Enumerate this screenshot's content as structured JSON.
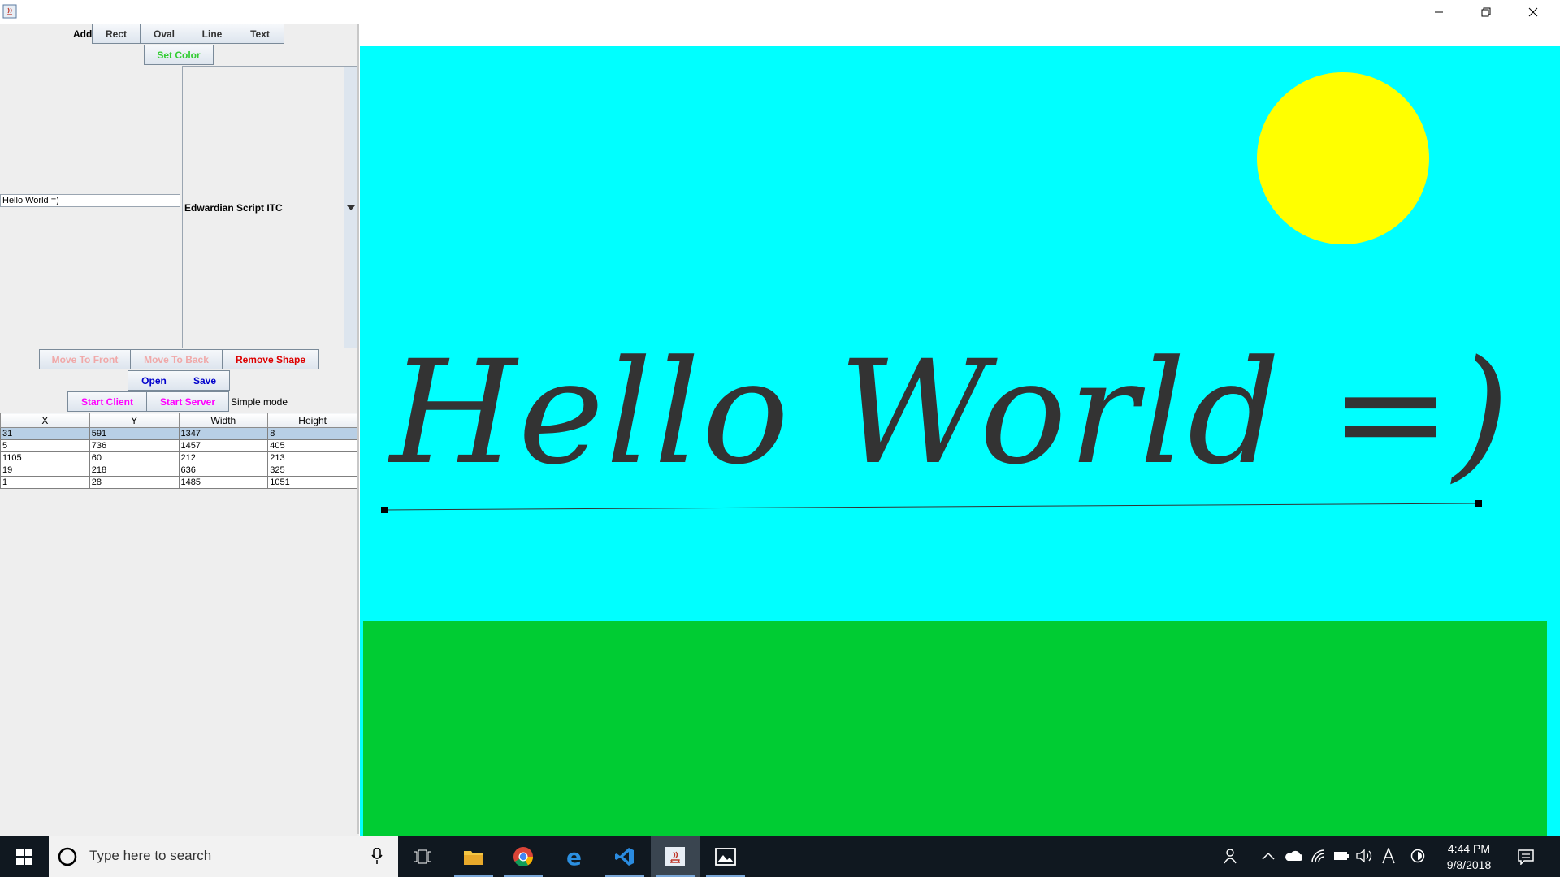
{
  "toolbar": {
    "add_label": "Add",
    "rect_label": "Rect",
    "oval_label": "Oval",
    "line_label": "Line",
    "text_label": "Text",
    "set_color_label": "Set Color"
  },
  "text_input": {
    "value": "Hello World =)"
  },
  "font_select": {
    "value": "Edwardian Script ITC"
  },
  "actions": {
    "move_front_label": "Move To Front",
    "move_back_label": "Move To Back",
    "remove_label": "Remove Shape",
    "open_label": "Open",
    "save_label": "Save",
    "start_client_label": "Start Client",
    "start_server_label": "Start Server",
    "mode_label": "Simple mode"
  },
  "table": {
    "headers": [
      "X",
      "Y",
      "Width",
      "Height"
    ],
    "rows": [
      [
        "31",
        "591",
        "1347",
        "8"
      ],
      [
        "5",
        "736",
        "1457",
        "405"
      ],
      [
        "1105",
        "60",
        "212",
        "213"
      ],
      [
        "19",
        "218",
        "636",
        "325"
      ],
      [
        "1",
        "28",
        "1485",
        "1051"
      ]
    ]
  },
  "canvas": {
    "text": "Hello World =)",
    "colors": {
      "sky": "#00ffff",
      "sun": "#ffff00",
      "grass": "#00cc33",
      "text": "#333333",
      "line": "#333333"
    }
  },
  "taskbar": {
    "search_placeholder": "Type here to search",
    "time": "4:44 PM",
    "date": "9/8/2018",
    "apps": [
      "task-view-icon",
      "file-explorer-icon",
      "chrome-icon",
      "edge-icon",
      "vscode-icon",
      "java-icon",
      "photos-icon"
    ]
  },
  "colors": {
    "set_color_text": "#33cc33",
    "remove_text": "#dd0000",
    "open_save_text": "#0000cc",
    "client_server_text": "#ff00ff",
    "disabled_text": "#f0a8a8"
  }
}
